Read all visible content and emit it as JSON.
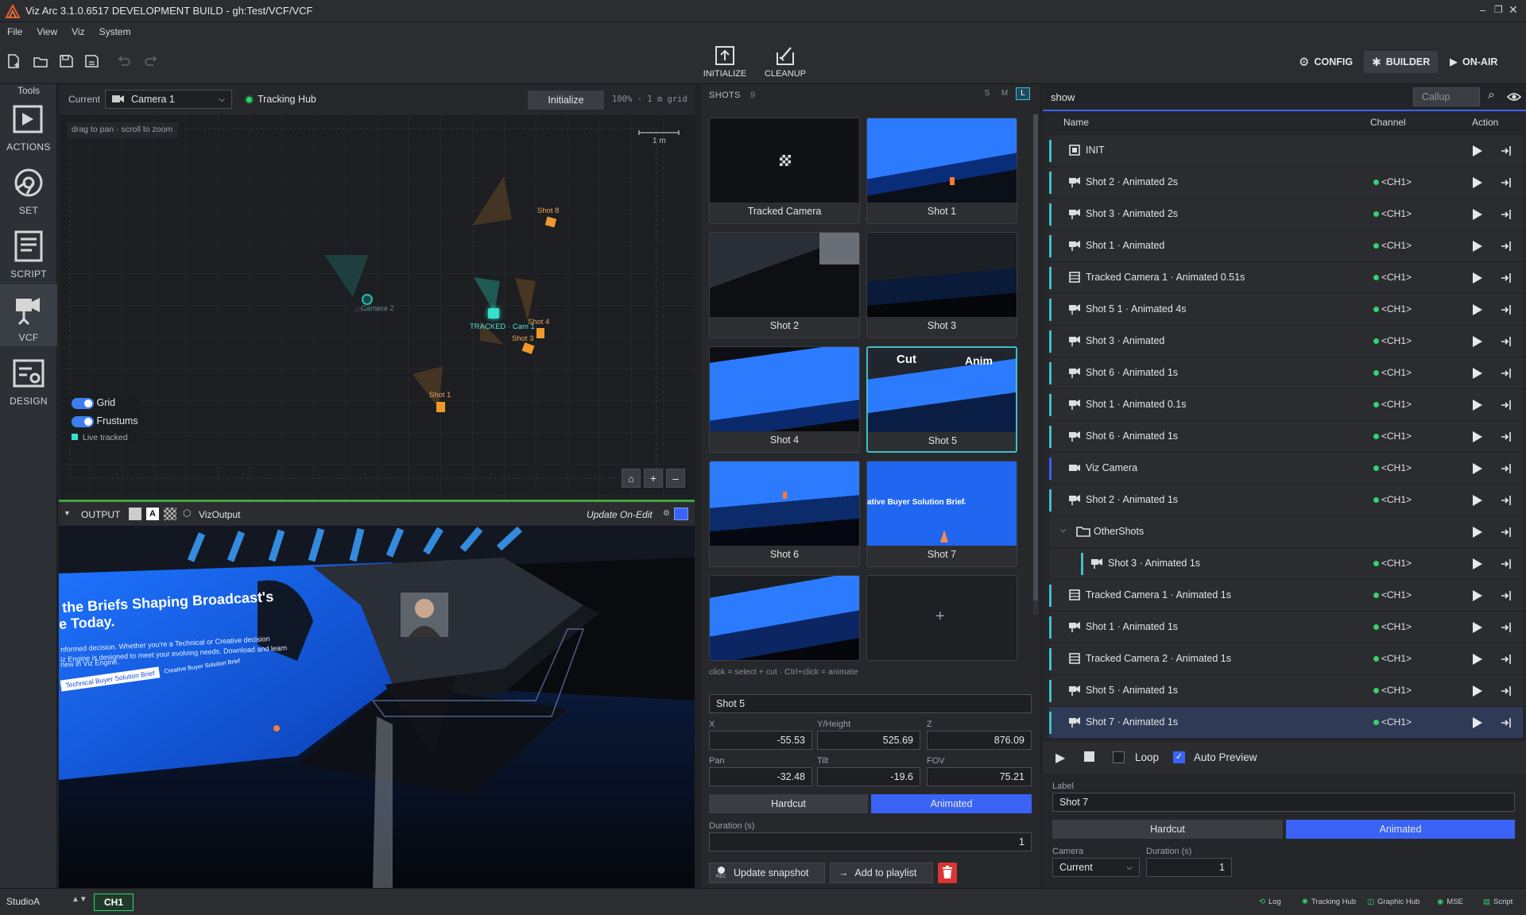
{
  "app": {
    "title": "Viz Arc 3.1.0.6517 DEVELOPMENT BUILD - gh:Test/VCF/VCF"
  },
  "menu": [
    "File",
    "View",
    "Viz",
    "System"
  ],
  "toolbar": {
    "initialize_label": "INITIALIZE",
    "cleanup_label": "CLEANUP",
    "config_label": "CONFIG",
    "builder_label": "BUILDER",
    "onair_label": "ON-AIR"
  },
  "tools": {
    "header": "Tools",
    "items": [
      "ACTIONS",
      "SET",
      "SCRIPT",
      "VCF",
      "DESIGN"
    ],
    "active": "VCF"
  },
  "map": {
    "current_label": "Current",
    "camera_select": "Camera 1",
    "tracking_hub_label": "Tracking Hub",
    "initialize_label": "Initialize",
    "zoom_info": "100% · 1 m grid",
    "hint": "drag to pan · scroll to zoom",
    "scale_label": "1 m",
    "toggles": {
      "grid": "Grid",
      "frustums": "Frustums",
      "live_tracked": "Live tracked"
    },
    "cameras": [
      "Shot 8",
      "Camera 2",
      "TRACKED · Cam 1",
      "Shot 4",
      "Shot 3",
      "Shot 1"
    ],
    "ghost_label": "placement"
  },
  "output": {
    "label": "OUTPUT",
    "engine": "VizOutput",
    "update_mode": "Update On-Edit",
    "scene_text": {
      "headline_1": "the Briefs Shaping Broadcast's",
      "headline_2": "e Today.",
      "body_1": "nformed decision. Whether you're a Technical or Creative decision",
      "body_2": "iz Engine is designed to meet your evolving needs. Download and learn",
      "body_3": "new in Viz Engine.",
      "button_1": "Technical Buyer Solution Brief",
      "button_2": "Creative Buyer Solution Brief"
    }
  },
  "shots": {
    "title": "SHOTS",
    "count": "9",
    "sizes": [
      "S",
      "M",
      "L"
    ],
    "active_size": "L",
    "tiles": [
      "Tracked Camera",
      "Shot 1",
      "Shot 2",
      "Shot 3",
      "Shot 4",
      "Shot 5",
      "Shot 6",
      "Shot 7"
    ],
    "selected": "Shot 5",
    "overlay_cut": "Cut",
    "overlay_anim": "Anim",
    "hint": "click = select + cut · Ctrl+click = animate",
    "shot7_caption": "ative Buyer Solution Brief",
    "editor": {
      "name": "Shot 5",
      "x_label": "X",
      "x": "-55.53",
      "y_label": "Y/Height",
      "y": "525.69",
      "z_label": "Z",
      "z": "876.09",
      "pan_label": "Pan",
      "pan": "-32.48",
      "tilt_label": "Tilt",
      "tilt": "-19.6",
      "fov_label": "FOV",
      "fov": "75.21",
      "hardcut": "Hardcut",
      "animated": "Animated",
      "duration_label": "Duration (s)",
      "duration": "1",
      "update_snapshot": "Update snapshot",
      "add_to_playlist": "Add to playlist",
      "rec_label": "REC"
    }
  },
  "playlist": {
    "name": "show",
    "callup_placeholder": "Callup",
    "columns": {
      "name": "Name",
      "channel": "Channel",
      "action": "Action"
    },
    "rows": [
      {
        "name": "INIT",
        "channel": "",
        "icon": "init"
      },
      {
        "name": "Shot 2 · Animated 2s",
        "channel": "<CH1>",
        "icon": "camera"
      },
      {
        "name": "Shot 3 · Animated 2s",
        "channel": "<CH1>",
        "icon": "camera"
      },
      {
        "name": "Shot 1 · Animated",
        "channel": "<CH1>",
        "icon": "camera"
      },
      {
        "name": "Tracked Camera 1 · Animated 0.51s",
        "channel": "<CH1>",
        "icon": "film"
      },
      {
        "name": "Shot 5 1 · Animated 4s",
        "channel": "<CH1>",
        "icon": "camera"
      },
      {
        "name": "Shot 3 · Animated",
        "channel": "<CH1>",
        "icon": "camera"
      },
      {
        "name": "Shot 6 · Animated 1s",
        "channel": "<CH1>",
        "icon": "camera"
      },
      {
        "name": "Shot 1 · Animated 0.1s",
        "channel": "<CH1>",
        "icon": "camera"
      },
      {
        "name": "Shot 6 · Animated 1s",
        "channel": "<CH1>",
        "icon": "camera"
      },
      {
        "name": "Viz Camera",
        "channel": "<CH1>",
        "icon": "vizcam"
      },
      {
        "name": "Shot 2 · Animated 1s",
        "channel": "<CH1>",
        "icon": "camera"
      },
      {
        "name": "OtherShots",
        "channel": "",
        "icon": "folder"
      },
      {
        "name": "Shot 3 · Animated 1s",
        "channel": "<CH1>",
        "icon": "camera"
      },
      {
        "name": "Tracked Camera 1 · Animated 1s",
        "channel": "<CH1>",
        "icon": "film"
      },
      {
        "name": "Shot 1 · Animated 1s",
        "channel": "<CH1>",
        "icon": "camera"
      },
      {
        "name": "Tracked Camera 2 · Animated 1s",
        "channel": "<CH1>",
        "icon": "film"
      },
      {
        "name": "Shot 5 · Animated 1s",
        "channel": "<CH1>",
        "icon": "camera"
      },
      {
        "name": "Shot 7 · Animated 1s",
        "channel": "<CH1>",
        "icon": "camera"
      }
    ],
    "selected_row": "Shot 7 · Animated 1s",
    "controls": {
      "loop": "Loop",
      "auto_preview": "Auto Preview",
      "auto_preview_checked": true,
      "loop_checked": false
    },
    "detail": {
      "label_caption": "Label",
      "label_value": "Shot 7",
      "hardcut": "Hardcut",
      "animated": "Animated",
      "camera_caption": "Camera",
      "camera_value": "Current",
      "duration_caption": "Duration (s)",
      "duration_value": "1"
    }
  },
  "status": {
    "profile": "StudioA",
    "channel": "CH1",
    "items": [
      "Log",
      "Tracking Hub",
      "Graphic Hub",
      "MSE",
      "Script"
    ]
  },
  "colors": {
    "accent": "#3fbfc7",
    "blue": "#3a63f5",
    "onair_green": "#35d16b",
    "delete_red": "#d93636"
  }
}
